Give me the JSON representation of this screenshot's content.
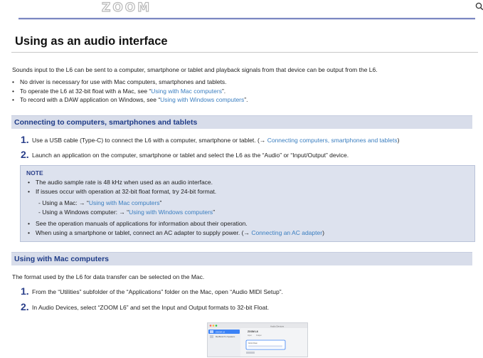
{
  "header": {
    "logo_text": "ZOOM",
    "search_icon": "search-icon"
  },
  "title": "Using as an audio interface",
  "intro": {
    "text": "Sounds input to the L6 can be sent to a computer, smartphone or tablet and playback signals from that device can be output from the L6.",
    "bullets": [
      {
        "text": "No driver is necessary for use with Mac computers, smartphones and tablets."
      },
      {
        "text": "To operate the L6 at 32-bit float with a Mac, see “",
        "link": "Using with Mac computers",
        "after": "”."
      },
      {
        "text": "To record with a DAW application on Windows, see “",
        "link": "Using with Windows computers",
        "after": "”."
      }
    ]
  },
  "section1": {
    "heading": "Connecting to computers, smartphones and tablets",
    "steps": [
      {
        "num": "1.",
        "text": "Use a USB cable (Type-C) to connect the L6 with a computer, smartphone or tablet. (→ ",
        "link": "Connecting computers, smartphones and tablets",
        "after": ")"
      },
      {
        "num": "2.",
        "text": "Launch an application on the computer, smartphone or tablet and select the L6 as the “Audio” or “Input/Output” device."
      }
    ],
    "note": {
      "label": "NOTE",
      "bullets": [
        {
          "text": "The audio sample rate is 48 kHz when used as an audio interface."
        },
        {
          "text": "If issues occur with operation at 32-bit float format, try 24-bit format."
        }
      ],
      "sub": [
        {
          "text": "- Using a Mac: → “",
          "link": "Using with Mac computers",
          "after": "”"
        },
        {
          "text": "- Using a Windows computer: → “",
          "link": "Using with Windows computers",
          "after": "”"
        }
      ],
      "bullets2": [
        {
          "text": "See the operation manuals of applications for information about their operation."
        },
        {
          "text": "When using a smartphone or tablet, connect an AC adapter to supply power. (→ ",
          "link": "Connecting an AC adapter",
          "after": ")"
        }
      ]
    }
  },
  "section2": {
    "heading": "Using with Mac computers",
    "intro": "The format used by the L6 for data transfer can be selected on the Mac.",
    "steps": [
      {
        "num": "1.",
        "text": "From the “Utilities” subfolder of the “Applications” folder on the Mac, open “Audio MIDI Setup”."
      },
      {
        "num": "2.",
        "text": "In Audio Devices, select “ZOOM L6” and set the Input and Output formats to 32-bit Float."
      }
    ],
    "screenshot": {
      "window_title": "Audio Devices",
      "device": "ZOOM L6",
      "device2": "MacBook Pro Speakers",
      "panel_title": "ZOOM L6",
      "tabs": [
        "Input",
        "Output"
      ],
      "format": "32-bit Float",
      "accent": "#3b82f6"
    }
  }
}
